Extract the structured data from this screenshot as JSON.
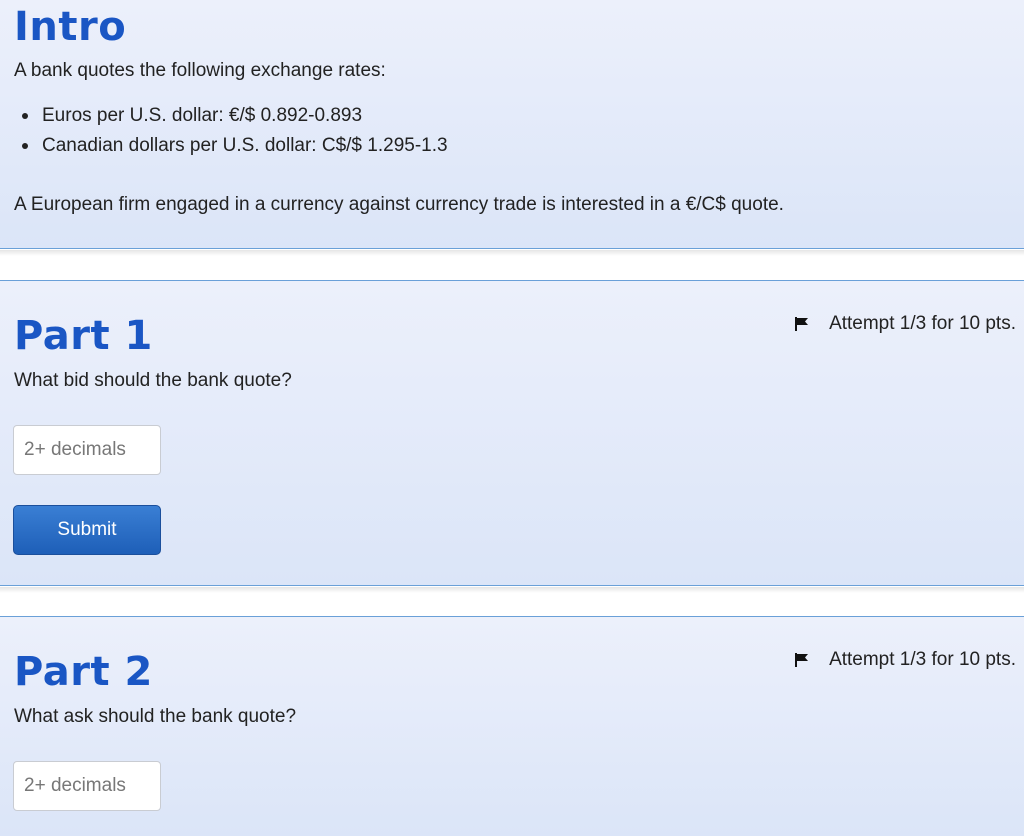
{
  "intro": {
    "title": "Intro",
    "lead": "A bank quotes the following exchange rates:",
    "rates": [
      "Euros per U.S. dollar: €/$ 0.892-0.893",
      "Canadian dollars per U.S. dollar: C$/$ 1.295-1.3"
    ],
    "context": "A European firm engaged in a currency against currency trade is interested in a €/C$ quote."
  },
  "parts": [
    {
      "title": "Part 1",
      "question": "What bid should the bank quote?",
      "attempt": "Attempt 1/3 for 10 pts.",
      "input_placeholder": "2+ decimals",
      "input_value": "",
      "submit_label": "Submit"
    },
    {
      "title": "Part 2",
      "question": "What ask should the bank quote?",
      "attempt": "Attempt 1/3 for 10 pts.",
      "input_placeholder": "2+ decimals",
      "input_value": ""
    }
  ],
  "icons": {
    "attempt_flag": "flag-icon"
  },
  "colors": {
    "heading": "#1a56c4",
    "card_top": "#ecf0fb",
    "card_bottom": "#dbe5f8",
    "border": "#6aa0d8",
    "submit": "#1e5fb8"
  }
}
